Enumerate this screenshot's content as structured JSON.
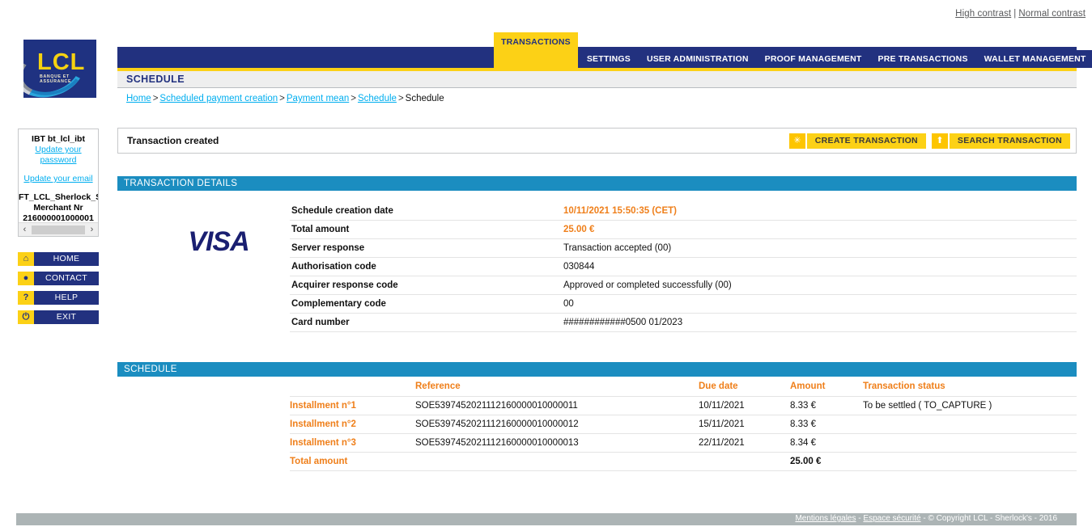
{
  "contrast": {
    "high": "High contrast",
    "separator": "|",
    "normal": "Normal contrast"
  },
  "brand": {
    "name": "LCL",
    "tagline": "BANQUE ET ASSURANCE"
  },
  "nav": {
    "tabs": [
      {
        "label": "TRANSACTIONS",
        "active": true
      },
      {
        "label": "SETTINGS",
        "active": false
      },
      {
        "label": "USER ADMINISTRATION",
        "active": false
      },
      {
        "label": "PROOF MANAGEMENT",
        "active": false
      },
      {
        "label": "PRE TRANSACTIONS",
        "active": false
      },
      {
        "label": "WALLET MANAGEMENT",
        "active": false
      }
    ]
  },
  "page": {
    "title": "SCHEDULE"
  },
  "breadcrumb": {
    "items": [
      "Home",
      "Scheduled payment creation",
      "Payment mean",
      "Schedule"
    ],
    "current": "Schedule",
    "separator": ">"
  },
  "sidebar": {
    "merchant": {
      "ibt": "IBT bt_lcl_ibt",
      "update_password": "Update your password",
      "update_email": "Update your email",
      "account": "FT_LCL_Sherlock_S",
      "merchant_label": "Merchant Nr",
      "merchant_number": "216000001000001",
      "scroll_left": "‹",
      "scroll_right": "›"
    },
    "buttons": [
      {
        "label": "HOME",
        "icon": "home-icon",
        "glyph": "⌂"
      },
      {
        "label": "CONTACT",
        "icon": "speech-bubble-icon",
        "glyph": "●"
      },
      {
        "label": "HELP",
        "icon": "question-mark-icon",
        "glyph": "?"
      },
      {
        "label": "EXIT",
        "icon": "power-icon",
        "glyph": "⏻"
      }
    ]
  },
  "message": {
    "text": "Transaction created"
  },
  "actions": [
    {
      "label": "CREATE TRANSACTION",
      "icon": "star-burst-icon",
      "glyph": "✳"
    },
    {
      "label": "SEARCH TRANSACTION",
      "icon": "walking-person-icon",
      "glyph": "⬆"
    }
  ],
  "transaction_details": {
    "section_title": "TRANSACTION DETAILS",
    "card_brand": "VISA",
    "rows": [
      {
        "key": "Schedule creation date",
        "value": "10/11/2021 15:50:35 (CET)",
        "highlight": true
      },
      {
        "key": "Total amount",
        "value": "25.00 €",
        "highlight": true
      },
      {
        "key": "Server response",
        "value": "Transaction accepted (00)",
        "highlight": false
      },
      {
        "key": "Authorisation code",
        "value": "030844",
        "highlight": false
      },
      {
        "key": "Acquirer response code",
        "value": "Approved or completed successfully (00)",
        "highlight": false
      },
      {
        "key": "Complementary code",
        "value": "00",
        "highlight": false
      },
      {
        "key": "Card number",
        "value": "############0500  01/2023",
        "highlight": false
      }
    ]
  },
  "schedule": {
    "section_title": "SCHEDULE",
    "headers": [
      "",
      "Reference",
      "Due date",
      "Amount",
      "Transaction status"
    ],
    "rows": [
      {
        "label": "Installment n°1",
        "reference": "SOE5397452021112160000010000011",
        "due_date": "10/11/2021",
        "amount": "8.33 €",
        "status": "To be settled ( TO_CAPTURE )"
      },
      {
        "label": "Installment n°2",
        "reference": "SOE5397452021112160000010000012",
        "due_date": "15/11/2021",
        "amount": "8.33 €",
        "status": ""
      },
      {
        "label": "Installment n°3",
        "reference": "SOE5397452021112160000010000013",
        "due_date": "22/11/2021",
        "amount": "8.34 €",
        "status": ""
      }
    ],
    "total": {
      "label": "Total amount",
      "reference": "",
      "due_date": "",
      "amount": "25.00 €",
      "status": ""
    }
  },
  "footer": {
    "legal": "Mentions légales",
    "security": "Espace sécurité",
    "copyright": "© Copyright LCL - Sherlock's - 2016",
    "separator": "-"
  },
  "colors": {
    "brand_blue": "#22317f",
    "brand_yellow": "#fcd116",
    "section_blue": "#1b8dc0",
    "accent_orange": "#ef7f1a",
    "link_cyan": "#00aeef",
    "footer_gray": "#acb4b5"
  }
}
